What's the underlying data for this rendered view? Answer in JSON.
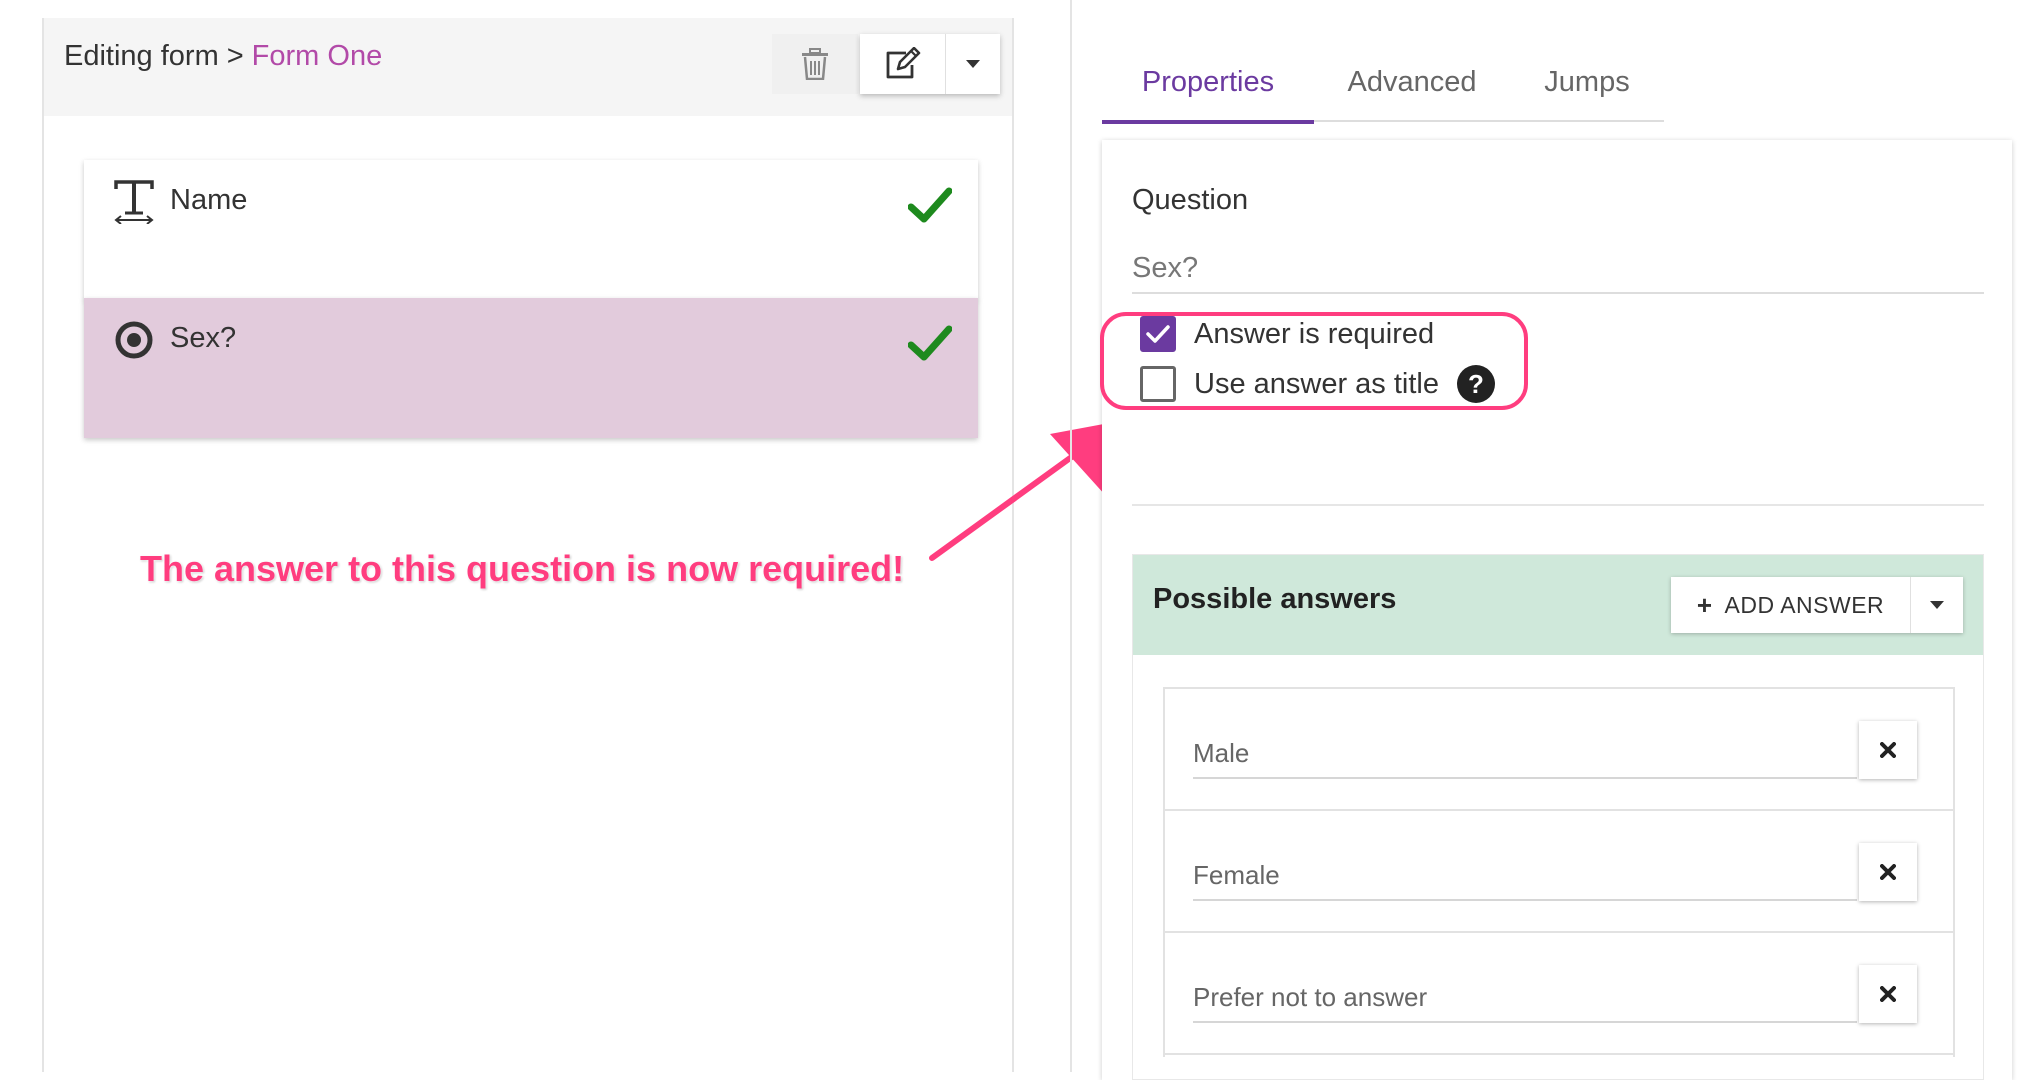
{
  "header": {
    "breadcrumb_prefix": "Editing form",
    "breadcrumb_separator": ">",
    "form_name": "Form One",
    "icons": {
      "delete": "trash-icon",
      "edit": "edit-icon",
      "menu": "caret-down-icon"
    }
  },
  "questions": [
    {
      "label": "Name",
      "icon": "text-type-icon",
      "status": "check-icon",
      "selected": false
    },
    {
      "label": "Sex?",
      "icon": "radio-type-icon",
      "status": "check-icon",
      "selected": true
    }
  ],
  "annotation": {
    "text": "The answer to this question is now required!",
    "color": "#ff3d7f"
  },
  "tabs": [
    {
      "label": "Properties",
      "active": true
    },
    {
      "label": "Advanced",
      "active": false
    },
    {
      "label": "Jumps",
      "active": false
    }
  ],
  "properties": {
    "question_label": "Question",
    "question_value": "Sex?",
    "required_label": "Answer is required",
    "required_checked": true,
    "title_label": "Use answer as title",
    "title_checked": false,
    "help_icon": "help-icon"
  },
  "answers": {
    "title": "Possible answers",
    "add_button_label": "ADD ANSWER",
    "items": [
      "Male",
      "Female",
      "Prefer not to answer"
    ]
  },
  "colors": {
    "accent_purple": "#6b3aa0",
    "form_name_pink": "#b24aa8",
    "selected_card": "#e2cbdc",
    "answers_header": "#cfe8da",
    "success_green": "#1e8a1e"
  }
}
